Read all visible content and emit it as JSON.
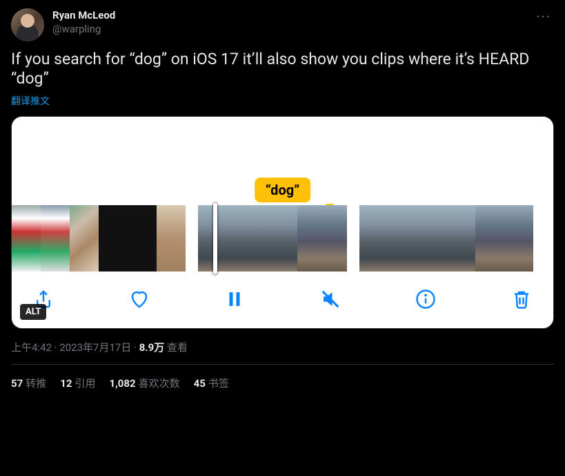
{
  "author": {
    "display_name": "Ryan McLeod",
    "handle": "@warpling"
  },
  "tweet": {
    "text": "If you search for “dog” on iOS 17 it’ll also show you clips where it’s HEARD “dog”",
    "translate_label": "翻译推文"
  },
  "media": {
    "search_tag": "“dog”",
    "alt_badge": "ALT"
  },
  "meta": {
    "time": "上午4:42",
    "date": "2023年7月17日",
    "sep": " · ",
    "views_value": "8.9万",
    "views_label": " 查看"
  },
  "stats": {
    "retweets": {
      "value": "57",
      "label": "转推"
    },
    "quotes": {
      "value": "12",
      "label": "引用"
    },
    "likes": {
      "value": "1,082",
      "label": "喜欢次数"
    },
    "bookmarks": {
      "value": "45",
      "label": "书签"
    }
  }
}
